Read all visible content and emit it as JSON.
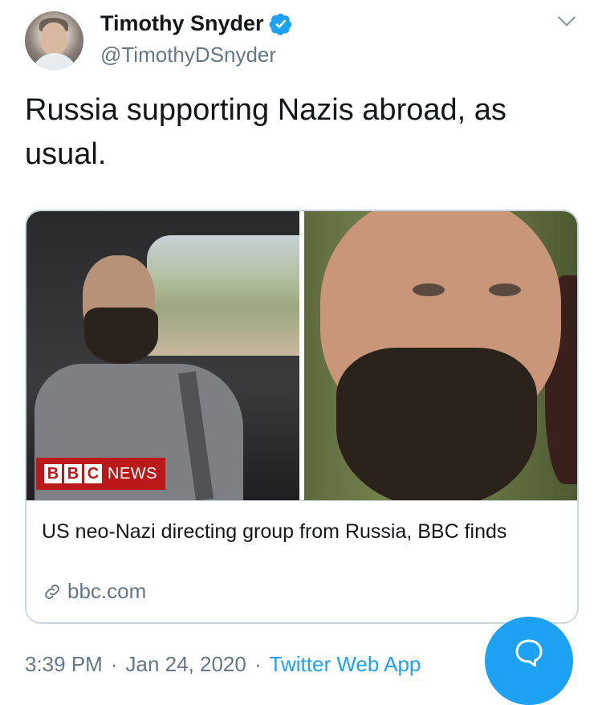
{
  "author": {
    "display_name": "Timothy Snyder",
    "handle": "@TimothyDSnyder",
    "verified": true
  },
  "tweet": {
    "text": "Russia supporting Nazis abroad, as usual."
  },
  "card": {
    "badge": {
      "blocks": [
        "B",
        "B",
        "C"
      ],
      "label": "NEWS"
    },
    "title": "US neo-Nazi directing group from Russia, BBC finds",
    "domain": "bbc.com"
  },
  "meta": {
    "time": "3:39 PM",
    "separator": "·",
    "date": "Jan 24, 2020",
    "source": "Twitter Web App"
  },
  "icons": {
    "verified": "verified-badge-icon",
    "caret": "chevron-down-icon",
    "link": "link-icon",
    "reply_fab": "speech-bubble-icon"
  },
  "colors": {
    "accent": "#1da1f2",
    "secondary_text": "#657786",
    "primary_text": "#14171a",
    "bbc_red": "#bb1919",
    "border": "#ccd6dd"
  }
}
